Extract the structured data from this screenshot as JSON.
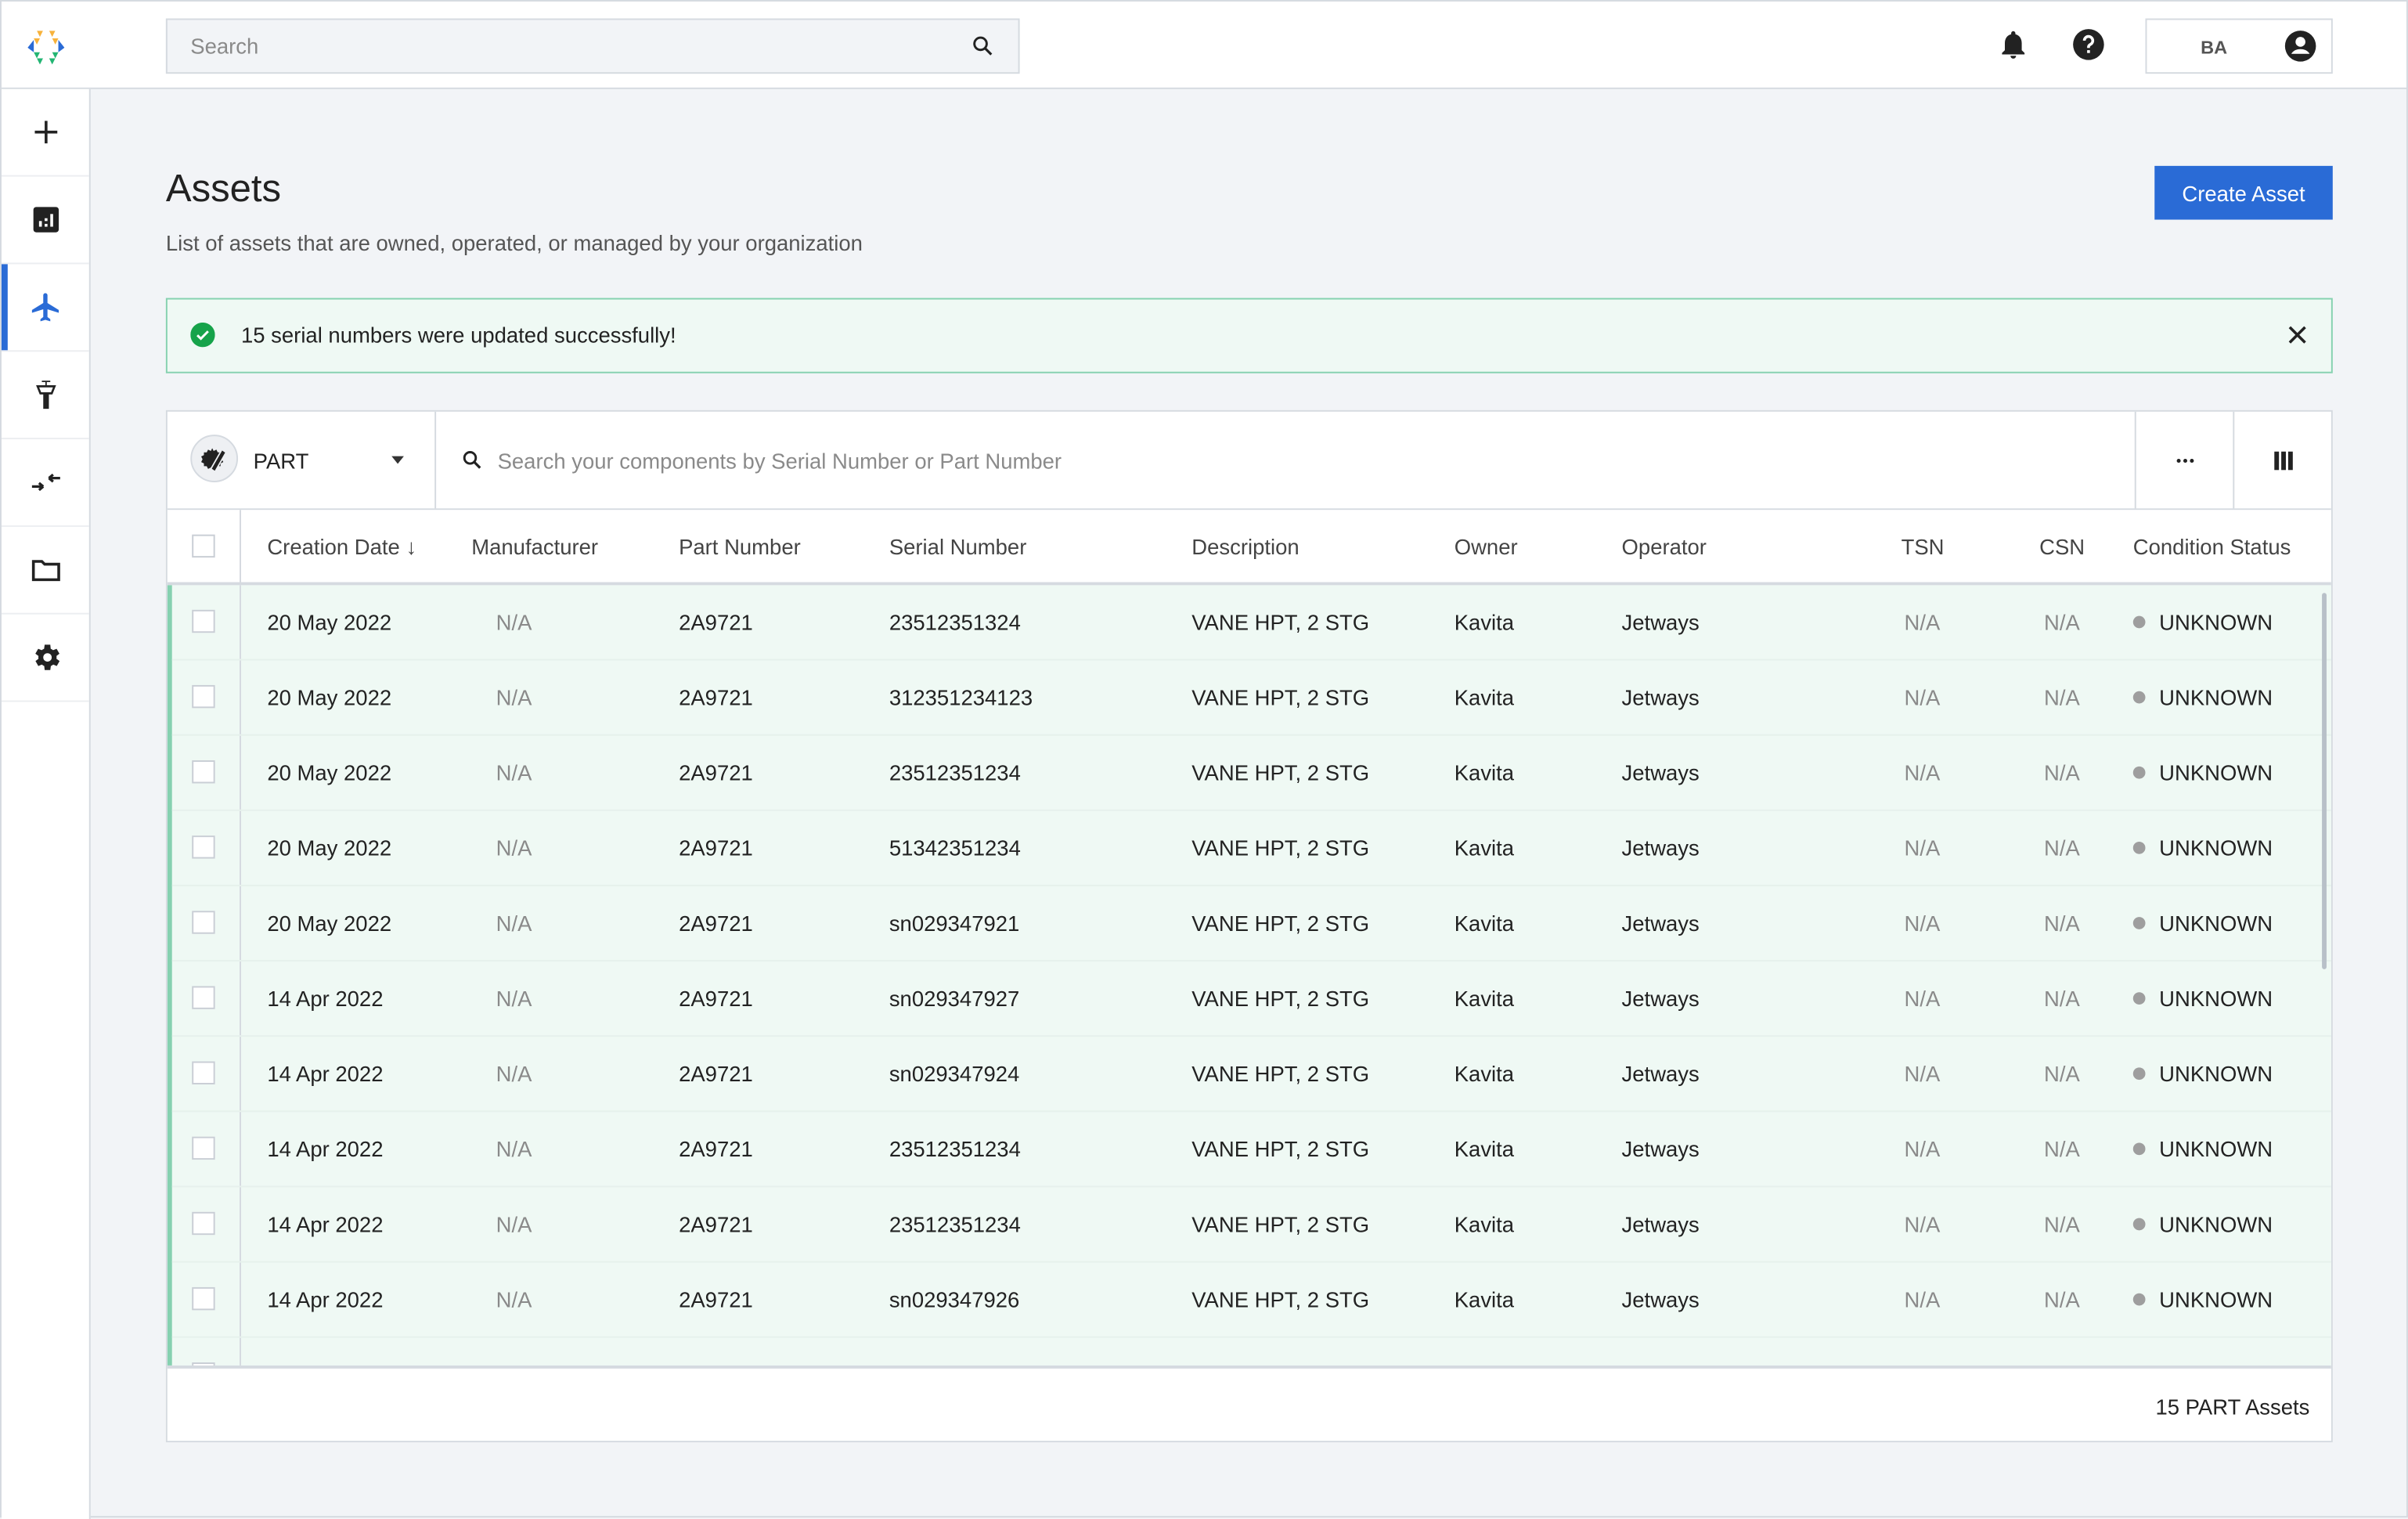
{
  "topbar": {
    "search_placeholder": "Search",
    "user_initials": "BA",
    "icons": [
      "logo-icon",
      "search-icon",
      "bell-icon",
      "help-icon",
      "account-icon"
    ]
  },
  "sidebar": {
    "items": [
      {
        "name": "add",
        "icon": "plus-icon",
        "active": false
      },
      {
        "name": "dashboard",
        "icon": "chart-icon",
        "active": false
      },
      {
        "name": "assets",
        "icon": "airplane-icon",
        "active": true
      },
      {
        "name": "airports",
        "icon": "control-tower-icon",
        "active": false
      },
      {
        "name": "transfers",
        "icon": "swap-arrows-icon",
        "active": false
      },
      {
        "name": "documents",
        "icon": "folder-icon",
        "active": false
      },
      {
        "name": "settings",
        "icon": "gear-icon",
        "active": false
      }
    ],
    "accent_color": "#2a6bd6"
  },
  "page": {
    "title": "Assets",
    "subtitle": "List of assets that are owned, operated, or managed by your organization",
    "create_button": "Create Asset"
  },
  "alert": {
    "message": "15 serial numbers were updated successfully!",
    "status_color": "#16a34a"
  },
  "filters": {
    "asset_type": "PART",
    "search_placeholder": "Search your components by Serial Number or Part Number",
    "more_label": "···"
  },
  "table": {
    "columns": [
      "Creation Date",
      "Manufacturer",
      "Part Number",
      "Serial Number",
      "Description",
      "Owner",
      "Operator",
      "TSN",
      "CSN",
      "Condition Status"
    ],
    "sort_column": "Creation Date",
    "sort_direction": "desc",
    "rows": [
      {
        "date": "20 May 2022",
        "manufacturer": "N/A",
        "part": "2A9721",
        "serial": "23512351324",
        "description": "VANE HPT, 2 STG",
        "owner": "Kavita",
        "operator": "Jetways",
        "tsn": "N/A",
        "csn": "N/A",
        "status": "UNKNOWN"
      },
      {
        "date": "20 May 2022",
        "manufacturer": "N/A",
        "part": "2A9721",
        "serial": "312351234123",
        "description": "VANE HPT, 2 STG",
        "owner": "Kavita",
        "operator": "Jetways",
        "tsn": "N/A",
        "csn": "N/A",
        "status": "UNKNOWN"
      },
      {
        "date": "20 May 2022",
        "manufacturer": "N/A",
        "part": "2A9721",
        "serial": "23512351234",
        "description": "VANE HPT, 2 STG",
        "owner": "Kavita",
        "operator": "Jetways",
        "tsn": "N/A",
        "csn": "N/A",
        "status": "UNKNOWN"
      },
      {
        "date": "20 May 2022",
        "manufacturer": "N/A",
        "part": "2A9721",
        "serial": "51342351234",
        "description": "VANE HPT, 2 STG",
        "owner": "Kavita",
        "operator": "Jetways",
        "tsn": "N/A",
        "csn": "N/A",
        "status": "UNKNOWN"
      },
      {
        "date": "20 May 2022",
        "manufacturer": "N/A",
        "part": "2A9721",
        "serial": "sn029347921",
        "description": "VANE HPT, 2 STG",
        "owner": "Kavita",
        "operator": "Jetways",
        "tsn": "N/A",
        "csn": "N/A",
        "status": "UNKNOWN"
      },
      {
        "date": "14 Apr 2022",
        "manufacturer": "N/A",
        "part": "2A9721",
        "serial": "sn029347927",
        "description": "VANE HPT, 2 STG",
        "owner": "Kavita",
        "operator": "Jetways",
        "tsn": "N/A",
        "csn": "N/A",
        "status": "UNKNOWN"
      },
      {
        "date": "14 Apr 2022",
        "manufacturer": "N/A",
        "part": "2A9721",
        "serial": "sn029347924",
        "description": "VANE HPT, 2 STG",
        "owner": "Kavita",
        "operator": "Jetways",
        "tsn": "N/A",
        "csn": "N/A",
        "status": "UNKNOWN"
      },
      {
        "date": "14 Apr 2022",
        "manufacturer": "N/A",
        "part": "2A9721",
        "serial": "23512351234",
        "description": "VANE HPT, 2 STG",
        "owner": "Kavita",
        "operator": "Jetways",
        "tsn": "N/A",
        "csn": "N/A",
        "status": "UNKNOWN"
      },
      {
        "date": "14 Apr 2022",
        "manufacturer": "N/A",
        "part": "2A9721",
        "serial": "23512351234",
        "description": "VANE HPT, 2 STG",
        "owner": "Kavita",
        "operator": "Jetways",
        "tsn": "N/A",
        "csn": "N/A",
        "status": "UNKNOWN"
      },
      {
        "date": "14 Apr 2022",
        "manufacturer": "N/A",
        "part": "2A9721",
        "serial": "sn029347926",
        "description": "VANE HPT, 2 STG",
        "owner": "Kavita",
        "operator": "Jetways",
        "tsn": "N/A",
        "csn": "N/A",
        "status": "UNKNOWN"
      }
    ],
    "footer_count": "15 PART Assets"
  }
}
